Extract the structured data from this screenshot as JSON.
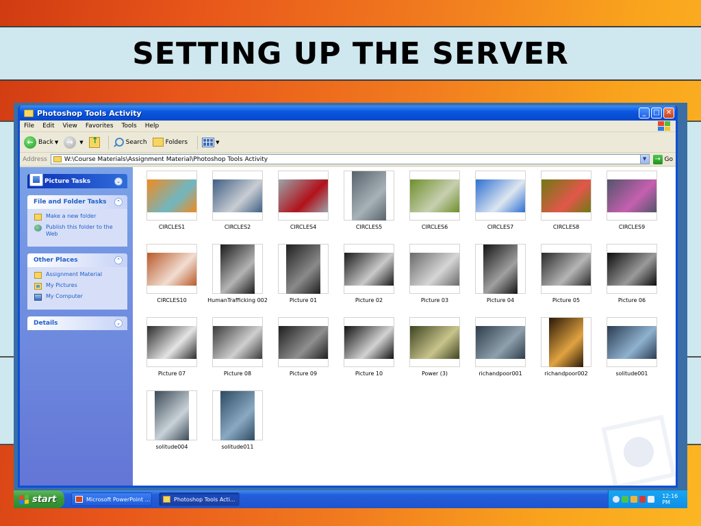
{
  "slide": {
    "title": "SETTING UP THE SERVER"
  },
  "window": {
    "title": "Photoshop Tools Activity",
    "menu": [
      "File",
      "Edit",
      "View",
      "Favorites",
      "Tools",
      "Help"
    ],
    "toolbar": {
      "back": "Back",
      "search": "Search",
      "folders": "Folders"
    },
    "address": {
      "label": "Address",
      "path": "W:\\Course Materials\\Assignment Material\\Photoshop Tools Activity",
      "go": "Go"
    }
  },
  "task_pane": {
    "picture_tasks": "Picture Tasks",
    "file_folder_tasks": {
      "title": "File and Folder Tasks",
      "links": [
        "Make a new folder",
        "Publish this folder to the Web"
      ]
    },
    "other_places": {
      "title": "Other Places",
      "links": [
        "Assignment Material",
        "My Pictures",
        "My Computer"
      ]
    },
    "details": "Details"
  },
  "files": [
    {
      "name": "CIRCLES1",
      "orientation": "landscape",
      "colors": [
        "#f28a1e",
        "#6fb7c3"
      ]
    },
    {
      "name": "CIRCLES2",
      "orientation": "landscape",
      "colors": [
        "#3f5f84",
        "#c9cdd3"
      ]
    },
    {
      "name": "CIRCLES4",
      "orientation": "landscape",
      "colors": [
        "#9aa4aa",
        "#b2121b"
      ]
    },
    {
      "name": "CIRCLES5",
      "orientation": "portrait",
      "colors": [
        "#58626b",
        "#a7b2b8"
      ]
    },
    {
      "name": "CIRCLES6",
      "orientation": "landscape",
      "colors": [
        "#6f8f2c",
        "#c7cfb0"
      ]
    },
    {
      "name": "CIRCLES7",
      "orientation": "landscape",
      "colors": [
        "#2d6fd4",
        "#dde6ef"
      ]
    },
    {
      "name": "CIRCLES8",
      "orientation": "landscape",
      "colors": [
        "#6f7a14",
        "#e2574a"
      ]
    },
    {
      "name": "CIRCLES9",
      "orientation": "landscape",
      "colors": [
        "#53546a",
        "#c560b0"
      ]
    },
    {
      "name": "CIRCLES10",
      "orientation": "landscape",
      "colors": [
        "#b95a2a",
        "#f1ddd1"
      ]
    },
    {
      "name": "HumanTrafficking 002",
      "orientation": "portrait",
      "colors": [
        "#1b1b1b",
        "#b4b4b4"
      ]
    },
    {
      "name": "Picture 01",
      "orientation": "portrait",
      "colors": [
        "#1f1f1f",
        "#8a8a8a"
      ]
    },
    {
      "name": "Picture 02",
      "orientation": "landscape",
      "colors": [
        "#1a1a1a",
        "#c9c9c9"
      ]
    },
    {
      "name": "Picture 03",
      "orientation": "landscape",
      "colors": [
        "#6a6a6a",
        "#d6d6d6"
      ]
    },
    {
      "name": "Picture 04",
      "orientation": "portrait",
      "colors": [
        "#141414",
        "#a0a0a0"
      ]
    },
    {
      "name": "Picture 05",
      "orientation": "landscape",
      "colors": [
        "#2a2a2a",
        "#b5b5b5"
      ]
    },
    {
      "name": "Picture 06",
      "orientation": "landscape",
      "colors": [
        "#0d0d0d",
        "#9a9a9a"
      ]
    },
    {
      "name": "Picture 07",
      "orientation": "landscape",
      "colors": [
        "#2b2b2b",
        "#e4e4e4"
      ]
    },
    {
      "name": "Picture 08",
      "orientation": "landscape",
      "colors": [
        "#3a3a3a",
        "#cfcfcf"
      ]
    },
    {
      "name": "Picture 09",
      "orientation": "landscape",
      "colors": [
        "#1e1e1e",
        "#8f8f8f"
      ]
    },
    {
      "name": "Picture 10",
      "orientation": "landscape",
      "colors": [
        "#111111",
        "#d2d2d2"
      ]
    },
    {
      "name": "Power (3)",
      "orientation": "landscape",
      "colors": [
        "#3e4420",
        "#c8c48c"
      ]
    },
    {
      "name": "richandpoor001",
      "orientation": "landscape",
      "colors": [
        "#2f3c4a",
        "#8ea0ad"
      ]
    },
    {
      "name": "richandpoor002",
      "orientation": "portrait",
      "colors": [
        "#2a1808",
        "#e0a340"
      ]
    },
    {
      "name": "solitude001",
      "orientation": "landscape",
      "colors": [
        "#2a3c52",
        "#8fb2cf"
      ]
    },
    {
      "name": "solitude004",
      "orientation": "portrait",
      "colors": [
        "#3b4a56",
        "#c9d2d8"
      ]
    },
    {
      "name": "solitude011",
      "orientation": "portrait",
      "colors": [
        "#2d4a62",
        "#8aa9c2"
      ]
    }
  ],
  "taskbar": {
    "start": "start",
    "tasks": [
      "Microsoft PowerPoint ...",
      "Photoshop Tools Acti..."
    ],
    "clock": "12:16 PM"
  }
}
